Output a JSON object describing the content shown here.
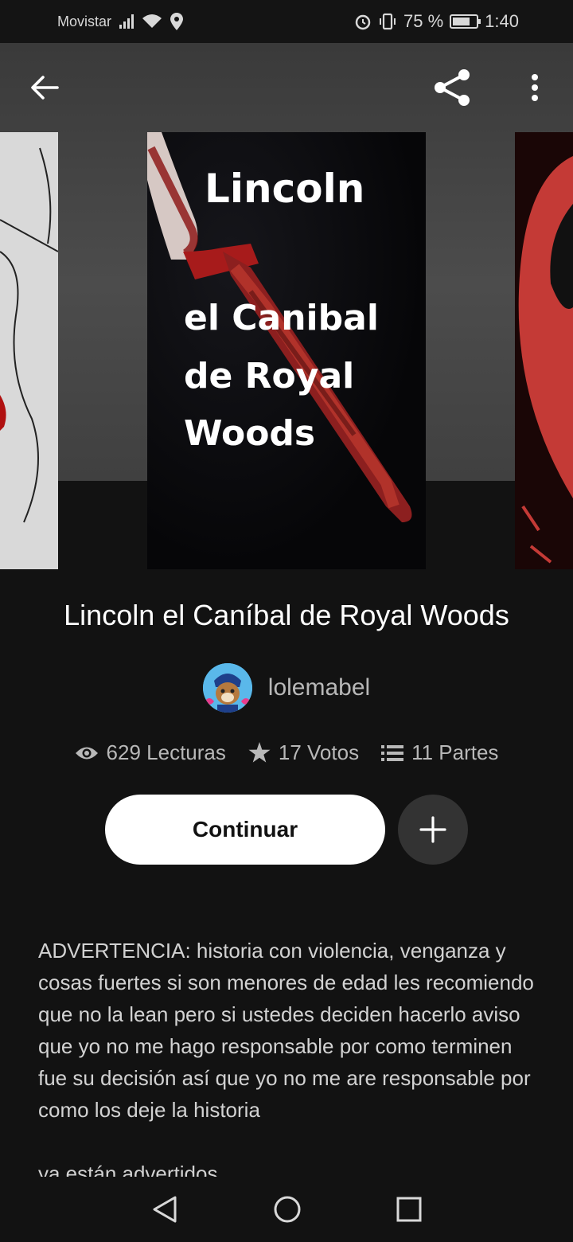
{
  "status_bar": {
    "carrier": "Movistar",
    "battery_text": "75 %",
    "battery_level": 0.75,
    "time": "1:40"
  },
  "cover": {
    "line1": "Lincoln",
    "line2": "el Canibal",
    "line3": "de Royal",
    "line4": "Woods"
  },
  "book": {
    "title": "Lincoln el Caníbal de Royal Woods",
    "author": "lolemabel",
    "reads": "629 Lecturas",
    "votes": "17 Votos",
    "parts": "11 Partes"
  },
  "actions": {
    "continue_label": "Continuar"
  },
  "description": {
    "paragraph1": "ADVERTENCIA: historia con violencia, venganza y cosas fuertes si son menores de edad les recomiendo que no la lean pero si ustedes deciden hacerlo aviso que yo no me hago responsable por como terminen fue su decisión así que yo no me are responsable por como los deje la historia",
    "paragraph2": "ya están advertidos"
  },
  "colors": {
    "background": "#121212",
    "button_bg": "#ffffff",
    "add_button_bg": "#333333",
    "secondary_text": "#b8b8b8"
  },
  "icons": [
    "back-arrow-icon",
    "share-icon",
    "more-vert-icon",
    "eye-icon",
    "star-icon",
    "list-icon",
    "plus-icon",
    "nav-back-icon",
    "nav-home-icon",
    "nav-recents-icon"
  ]
}
